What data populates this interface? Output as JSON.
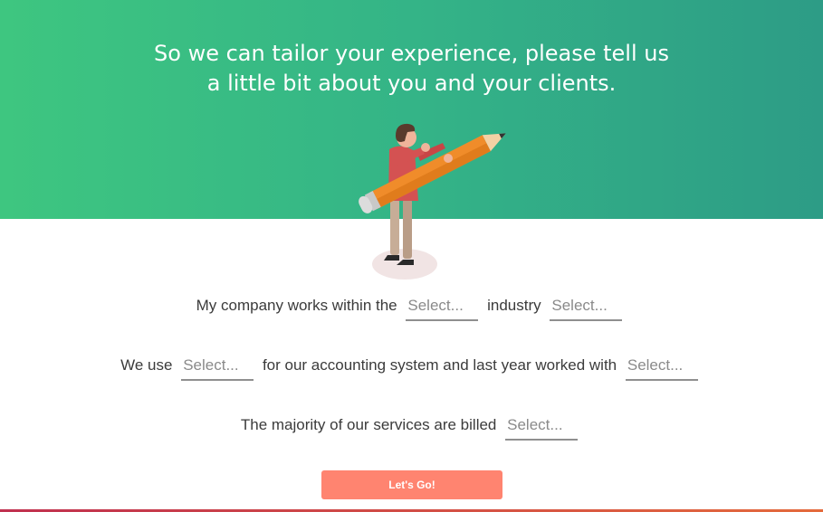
{
  "hero": {
    "title_line1": "So we can tailor your experience, please tell us",
    "title_line2": "a little bit about you and your clients.",
    "illustration": "person-holding-pencil"
  },
  "form": {
    "row1": {
      "text_before": "My company works within the",
      "select_1": "Select...",
      "text_middle": "industry",
      "select_2": "Select..."
    },
    "row2": {
      "text_before": "We use",
      "select_1": "Select...",
      "text_middle": "for our accounting system and last year worked with",
      "select_2": "Select..."
    },
    "row3": {
      "text_before": "The majority of our services are billed",
      "select_1": "Select..."
    }
  },
  "cta": {
    "label": "Let's Go!"
  },
  "colors": {
    "hero_start": "#3ec680",
    "hero_end": "#2d9c86",
    "button": "#ff8470",
    "text": "#3b3b3b",
    "placeholder": "#8a8a8a"
  }
}
